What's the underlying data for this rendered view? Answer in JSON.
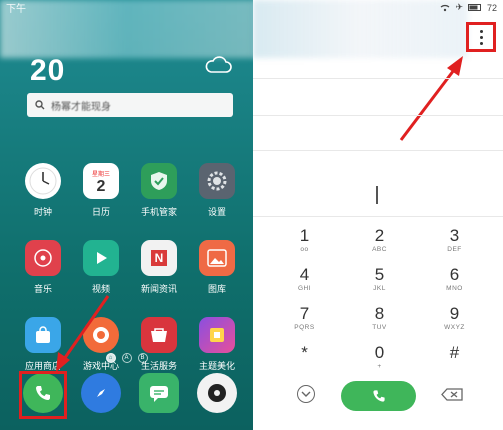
{
  "home": {
    "status_left": "下午",
    "clock": "20",
    "search_placeholder": "杨幂才能现身",
    "apps": [
      {
        "label": "时钟",
        "icon": "clock-icon"
      },
      {
        "label": "日历",
        "icon": "calendar-icon",
        "sub_a": "星期三",
        "sub_b": "2"
      },
      {
        "label": "手机管家",
        "icon": "shield-icon"
      },
      {
        "label": "设置",
        "icon": "gear-icon"
      },
      {
        "label": "音乐",
        "icon": "music-icon"
      },
      {
        "label": "视频",
        "icon": "video-play-icon"
      },
      {
        "label": "新闻资讯",
        "icon": "news-icon",
        "glyph": "N"
      },
      {
        "label": "图库",
        "icon": "gallery-icon"
      },
      {
        "label": "应用商店",
        "icon": "app-store-bag-icon"
      },
      {
        "label": "游戏中心",
        "icon": "game-center-icon"
      },
      {
        "label": "生活服务",
        "icon": "life-service-icon"
      },
      {
        "label": "主题美化",
        "icon": "theme-icon"
      }
    ],
    "page_dots": [
      "⌂",
      "A",
      "B"
    ],
    "dock": [
      {
        "icon": "phone-icon"
      },
      {
        "icon": "compass-icon"
      },
      {
        "icon": "message-icon"
      },
      {
        "icon": "camera-icon"
      }
    ]
  },
  "dialer": {
    "status": {
      "battery": "72"
    },
    "keys": [
      [
        {
          "d": "1",
          "s": "oo"
        },
        {
          "d": "2",
          "s": "ABC"
        },
        {
          "d": "3",
          "s": "DEF"
        }
      ],
      [
        {
          "d": "4",
          "s": "GHI"
        },
        {
          "d": "5",
          "s": "JKL"
        },
        {
          "d": "6",
          "s": "MNO"
        }
      ],
      [
        {
          "d": "7",
          "s": "PQRS"
        },
        {
          "d": "8",
          "s": "TUV"
        },
        {
          "d": "9",
          "s": "WXYZ"
        }
      ],
      [
        {
          "d": "*",
          "s": ""
        },
        {
          "d": "0",
          "s": "+"
        },
        {
          "d": "#",
          "s": ""
        }
      ]
    ]
  },
  "colors": {
    "accent_green": "#3fb65a",
    "highlight_red": "#e02020",
    "home_bg": "#167b7c"
  }
}
